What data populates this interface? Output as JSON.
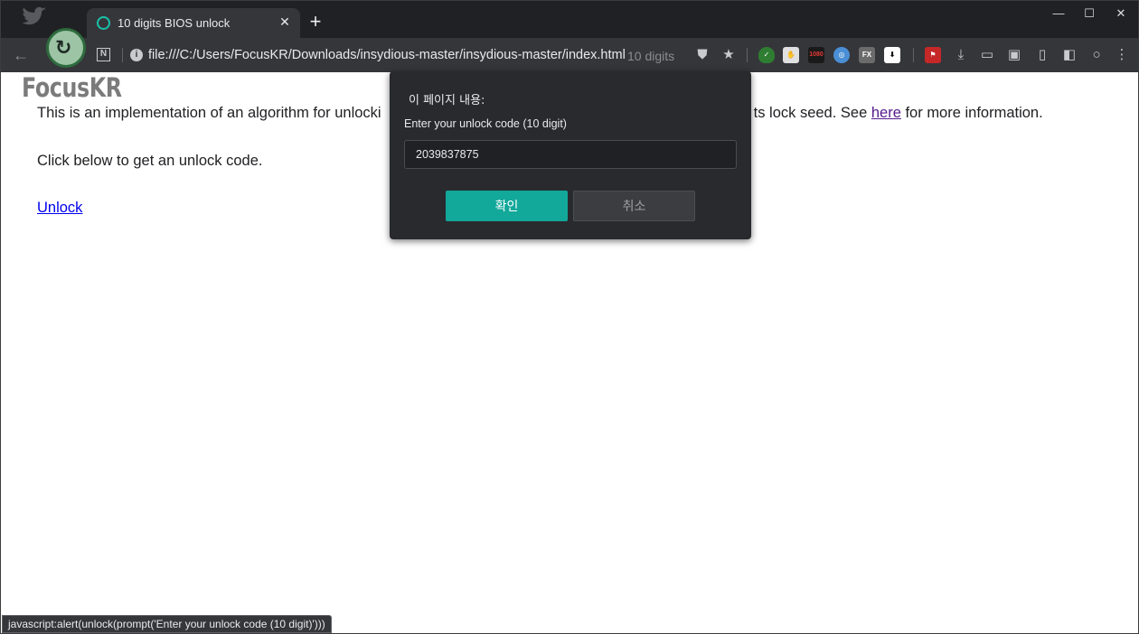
{
  "browser": {
    "tab_title": "10 digits BIOS unlock",
    "tab_close": "✕",
    "new_tab": "+",
    "url": "file:///C:/Users/FocusKR/Downloads/insydious-master/insydious-master/index.html",
    "url_hint": "10 digits",
    "window_minimize": "—",
    "window_maximize": "☐",
    "window_close": "✕",
    "extension_badges": {
      "ext_1080": "1080",
      "ext_fx": "FX"
    },
    "colors": {
      "titlebar": "#202124",
      "toolbar": "#35363a",
      "tab_accent": "#19c1a7"
    }
  },
  "page": {
    "watermark": "FocusKR",
    "para1_a": "This is an implementation of an algorithm for unlocki",
    "para1_b": "ts lock seed. See ",
    "para1_link": "here",
    "para1_c": " for more information.",
    "para2": "Click below to get an unlock code.",
    "unlock_link": "Unlock"
  },
  "dialog": {
    "title": "이 페이지 내용:",
    "message": "Enter your unlock code (10 digit)",
    "input_value": "2039837875",
    "ok_label": "확인",
    "cancel_label": "취소",
    "colors": {
      "ok": "#12a89a",
      "background": "#292a2d"
    }
  },
  "status_bar": {
    "text": "javascript:alert(unlock(prompt('Enter your unlock code (10 digit)')))"
  }
}
